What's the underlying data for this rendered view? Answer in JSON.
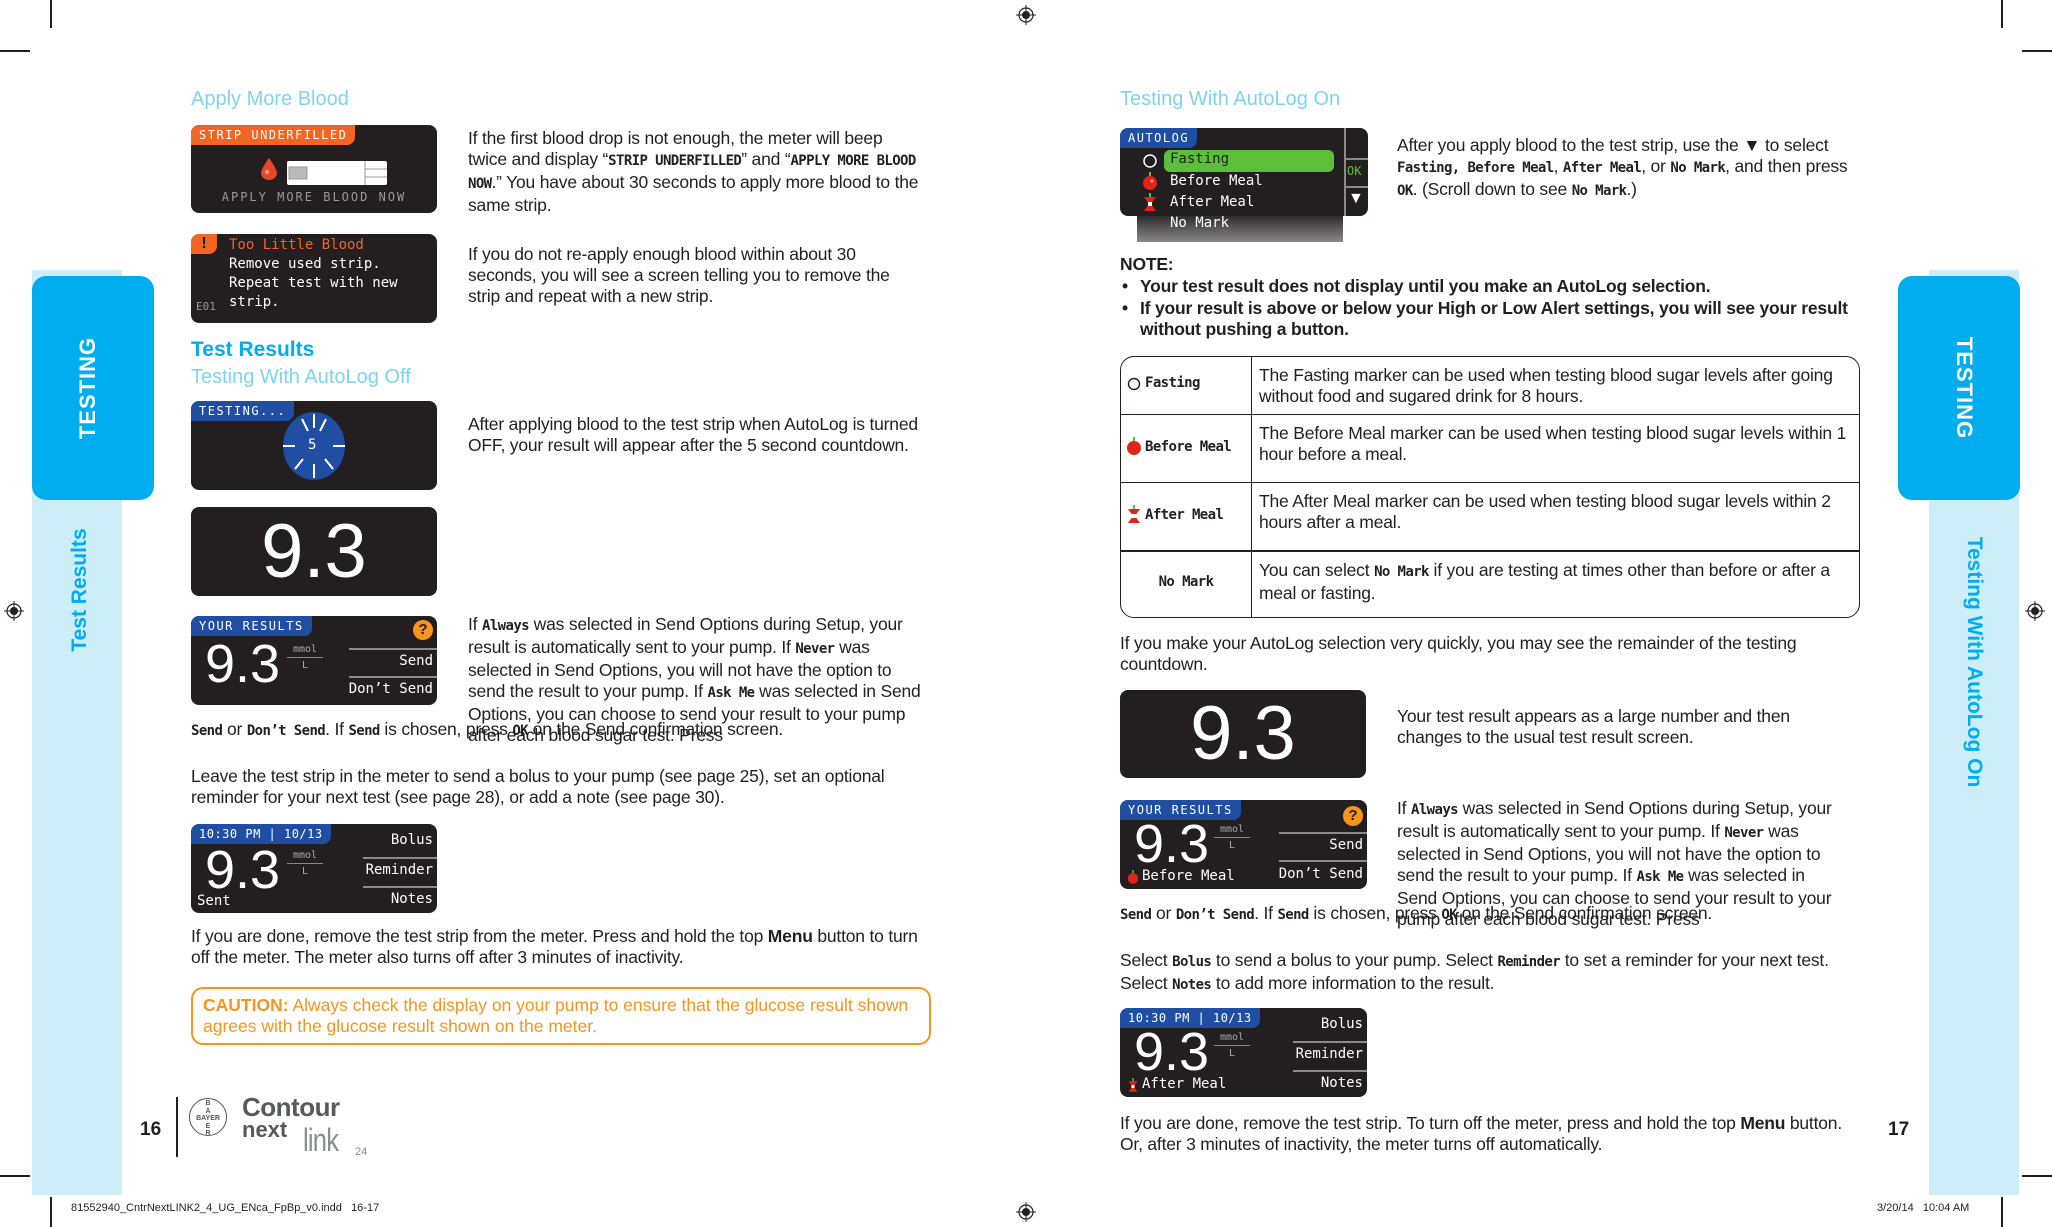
{
  "left_page": {
    "side_tab": {
      "section": "TESTING",
      "subsection": "Test Results"
    },
    "apply_more_blood": {
      "heading": "Apply More Blood",
      "screen_underfilled": {
        "header": "STRIP UNDERFILLED",
        "message": "APPLY MORE BLOOD NOW"
      },
      "text_1": {
        "p1": "If the first blood drop is not enough, the meter will beep twice and display “",
        "m1": "STRIP UNDERFILLED",
        "p2": "” and “",
        "m2": "APPLY MORE BLOOD NOW",
        "p3": ".” You have about 30 seconds to apply more blood to the same strip."
      },
      "screen_error": {
        "title": "Too Little Blood",
        "lines": [
          "Remove used strip.",
          "Repeat test with new",
          "strip."
        ],
        "code": "E01",
        "icon": "!"
      },
      "text_2": "If you do not re-apply enough blood within about 30 seconds, you will see a screen telling you to remove the strip and repeat with a new strip."
    },
    "test_results": {
      "heading": "Test Results",
      "subheading": "Testing With AutoLog Off",
      "screen_testing": {
        "header": "TESTING...",
        "countdown": "5"
      },
      "text_countdown": "After applying blood to the test strip when AutoLog is turned OFF, your result will appear after the 5 second countdown.",
      "screen_big": {
        "value": "9.3"
      },
      "screen_results": {
        "header": "YOUR RESULTS",
        "value": "9.3",
        "unit_top": "mmol",
        "unit_bottom": "L",
        "help": "?",
        "options": [
          "Send",
          "Don’t Send"
        ]
      },
      "text_send": {
        "s1": "If ",
        "m_always": "Always",
        "s2": " was selected in Send Options during Setup, your result is automatically sent to your pump. If ",
        "m_never": "Never",
        "s3": " was selected in Send Options, you will not have the option to send the result to your pump. If ",
        "m_askme": "Ask Me",
        "s4": " was selected in Send Options, you can choose to send your result to your pump after each blood sugar test. Press ",
        "m_send": "Send",
        "s5": " or ",
        "m_dontsend": "Don’t Send",
        "s6": ". If ",
        "m_send2": "Send",
        "s7": " is chosen, press ",
        "m_ok": "OK",
        "s8": " on the Send confirmation screen."
      },
      "text_leave": "Leave the test strip in the meter to send a bolus to your pump (see page 25), set an optional reminder for your next test (see page 28), or add a note (see page 30).",
      "screen_sent": {
        "header": "10:30 PM | 10/13",
        "value": "9.3",
        "unit_top": "mmol",
        "unit_bottom": "L",
        "status": "Sent",
        "options": [
          "Bolus",
          "Reminder",
          "Notes"
        ]
      },
      "text_done": {
        "p1": "If you are done, remove the test strip from the meter. Press and hold the top ",
        "bold": "Menu",
        "p2": " button to turn off the meter. The meter also turns off after 3 minutes of inactivity."
      },
      "caution": {
        "label": "CAUTION:",
        "text": " Always check the display on your pump to ensure that the glucose result shown agrees with the glucose result shown on the meter."
      }
    },
    "footer": {
      "page_number": "16",
      "logo_bayer": [
        "B",
        "A",
        "BAYER",
        "E",
        "R"
      ],
      "logo_line1": "Contour",
      "logo_line2": "next",
      "logo_line3": "link",
      "logo_sub": "24"
    }
  },
  "right_page": {
    "side_tab": {
      "section": "TESTING",
      "subsection": "Testing With AutoLog On"
    },
    "heading": "Testing With AutoLog On",
    "screen_autolog": {
      "header": "AUTOLOG",
      "items": [
        "Fasting",
        "Before Meal",
        "After Meal",
        "No Mark"
      ],
      "selected": "Fasting",
      "ok": "OK",
      "down": "▼"
    },
    "text_autolog": {
      "p1": "After you apply blood to the test strip, use the ▼ to select ",
      "m1": "Fasting, Before Meal",
      "p2": ", ",
      "m2": "After Meal",
      "p3": ", or ",
      "m3": "No Mark",
      "p4": ", and then press ",
      "m4": "OK",
      "p5": ". (Scroll down to see ",
      "m5": "No Mark",
      "p6": ".)"
    },
    "note": {
      "label": "NOTE:",
      "bullets": [
        "Your test result does not display until you make an AutoLog selection.",
        "If your result is above or below your High or Low Alert settings, you will see your result without pushing a button."
      ]
    },
    "marker_table": [
      {
        "marker": "Fasting",
        "icon": "fasting-circle",
        "desc": "The Fasting marker can be used when testing blood sugar levels after going without food and sugared drink for 8 hours."
      },
      {
        "marker": "Before Meal",
        "icon": "apple",
        "desc": "The Before Meal marker can be used when testing blood sugar levels within 1 hour before a meal."
      },
      {
        "marker": "After Meal",
        "icon": "apple-core",
        "desc": "The After Meal marker can be used when testing blood sugar levels within 2 hours after a meal."
      },
      {
        "marker": "No Mark",
        "icon": "",
        "desc_p1": "You can select ",
        "desc_m": "No Mark",
        "desc_p2": " if you are testing at times other than before or after a meal or fasting."
      }
    ],
    "text_quick": "If you make your AutoLog selection very quickly, you may see the remainder of the testing countdown.",
    "screen_big": {
      "value": "9.3"
    },
    "text_big": "Your test result appears as a large number and then changes to the usual test result screen.",
    "screen_results": {
      "header": "YOUR RESULTS",
      "value": "9.3",
      "unit_top": "mmol",
      "unit_bottom": "L",
      "help": "?",
      "marker": "Before Meal",
      "options": [
        "Send",
        "Don’t Send"
      ]
    },
    "text_send": {
      "s1": "If ",
      "m_always": "Always",
      "s2": " was selected in Send Options during Setup, your result is automatically sent to your pump. If ",
      "m_never": "Never",
      "s3": " was selected in Send Options, you will not have the option to send the result to your pump. If ",
      "m_askme": "Ask Me",
      "s4": " was selected in Send Options, you can choose to send your result to your pump after each blood sugar test. Press ",
      "m_send": "Send",
      "s5": " or ",
      "m_dontsend": "Don’t Send",
      "s6": ". If ",
      "m_send2": "Send",
      "s7": " is chosen, press ",
      "m_ok": "OK",
      "s8": " on the Send confirmation screen."
    },
    "text_select": {
      "p1": "Select ",
      "m1": "Bolus",
      "p2": " to send a bolus to your pump. Select ",
      "m2": "Reminder",
      "p3": " to set a reminder for your next test. Select ",
      "m3": "Notes",
      "p4": " to add more information to the result."
    },
    "screen_final": {
      "header": "10:30 PM | 10/13",
      "value": "9.3",
      "unit_top": "mmol",
      "unit_bottom": "L",
      "marker": "After Meal",
      "options": [
        "Bolus",
        "Reminder",
        "Notes"
      ]
    },
    "text_done": {
      "p1": "If you are done, remove the test strip. To turn off the meter, press and hold the top ",
      "bold": "Menu",
      "p2": " button. Or, after 3 minutes of inactivity, the meter turns off automatically."
    },
    "footer": {
      "page_number": "17"
    }
  },
  "slug": {
    "filename": "81552940_CntrNextLINK2_4_UG_ENca_FpBp_v0.indd   16-17",
    "datetime": "3/20/14   10:04 AM"
  },
  "colors": {
    "cyan": "#00aeef",
    "light_cyan": "#7fd3f2",
    "tab_light": "#cdeef9",
    "orange": "#f7941d",
    "screen_bg": "#231f20",
    "screen_blue": "#1f4ea3",
    "screen_orange": "#f26522",
    "green": "#5cbf3c"
  }
}
